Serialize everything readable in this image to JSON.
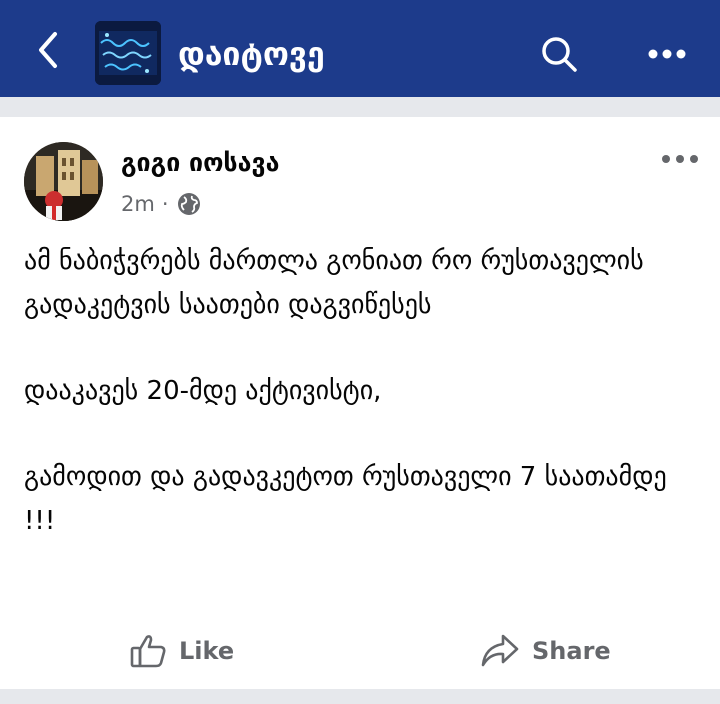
{
  "header": {
    "group_name": "დაიტოვე",
    "colors": {
      "background": "#1d3b8b",
      "text": "#ffffff"
    }
  },
  "post": {
    "author": "გიგი იოსავა",
    "time": "2m",
    "separator": "·",
    "paragraphs": [
      "ამ ნაბიჭვრებს მართლა გონიათ რო რუსთაველის გადაკეტვის საათები დაგვიწესეს",
      "დააკავეს 20-მდე აქტივისტი,",
      "გამოდით და გადავკეტოთ რუსთაველი 7 საათამდე !!!"
    ],
    "actions": {
      "like_label": "Like",
      "share_label": "Share"
    }
  },
  "icons": {
    "back": "chevron-left-icon",
    "search": "search-icon",
    "more": "more-horizontal-icon",
    "globe": "globe-icon",
    "like": "thumbs-up-icon",
    "share": "share-arrow-icon"
  }
}
